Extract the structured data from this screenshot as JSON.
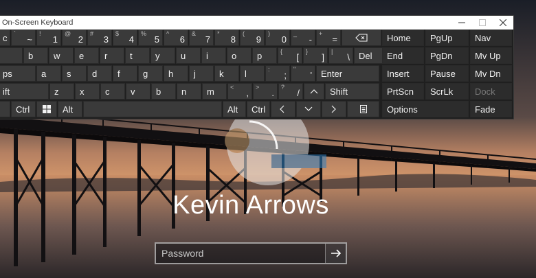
{
  "window": {
    "title": "On-Screen Keyboard"
  },
  "keyboard": {
    "row1": [
      {
        "main": "c",
        "sub": ""
      },
      {
        "main": "~",
        "sub": "` "
      },
      {
        "main": "1",
        "sub": "!"
      },
      {
        "main": "2",
        "sub": "@"
      },
      {
        "main": "3",
        "sub": "#"
      },
      {
        "main": "4",
        "sub": "$"
      },
      {
        "main": "5",
        "sub": "%"
      },
      {
        "main": "6",
        "sub": "^"
      },
      {
        "main": "7",
        "sub": "&"
      },
      {
        "main": "8",
        "sub": "*"
      },
      {
        "main": "9",
        "sub": "("
      },
      {
        "main": "0",
        "sub": ")"
      },
      {
        "main": "-",
        "sub": "_"
      },
      {
        "main": "=",
        "sub": "+"
      }
    ],
    "row2": [
      "b",
      "w",
      "e",
      "r",
      "t",
      "y",
      "u",
      "i",
      "o",
      "p"
    ],
    "row2_brackets": [
      {
        "main": "[",
        "sub": "{"
      },
      {
        "main": "]",
        "sub": "}"
      },
      {
        "main": "\\",
        "sub": "|"
      }
    ],
    "del": "Del",
    "row3_caps": "ps",
    "row3": [
      "a",
      "s",
      "d",
      "f",
      "g",
      "h",
      "j",
      "k",
      "l"
    ],
    "row3_punct": [
      {
        "main": ";",
        "sub": ":"
      },
      {
        "main": "'",
        "sub": "\""
      }
    ],
    "enter": "Enter",
    "row4_shift": "ift",
    "row4": [
      "z",
      "x",
      "c",
      "v",
      "b",
      "n",
      "m"
    ],
    "row4_punct": [
      {
        "main": ",",
        "sub": "<"
      },
      {
        "main": ".",
        "sub": ">"
      },
      {
        "main": "/",
        "sub": "?"
      }
    ],
    "shift": "Shift",
    "ctrl": "Ctrl",
    "alt": "Alt",
    "alt_right": "Alt",
    "ctrl_right": "Ctrl",
    "nav_keys": [
      [
        "Home",
        "PgUp",
        "Nav"
      ],
      [
        "End",
        "PgDn",
        "Mv Up"
      ],
      [
        "Insert",
        "Pause",
        "Mv Dn"
      ],
      [
        "PrtScn",
        "ScrLk",
        "Dock"
      ]
    ],
    "options": "Options",
    "fade": "Fade"
  },
  "login": {
    "user_name": "Kevin Arrows",
    "password_placeholder": "Password"
  },
  "colors": {
    "key_bg": "#3a3a3a",
    "window_bg": "#1f1f1f",
    "titlebar_bg": "#ffffff"
  }
}
